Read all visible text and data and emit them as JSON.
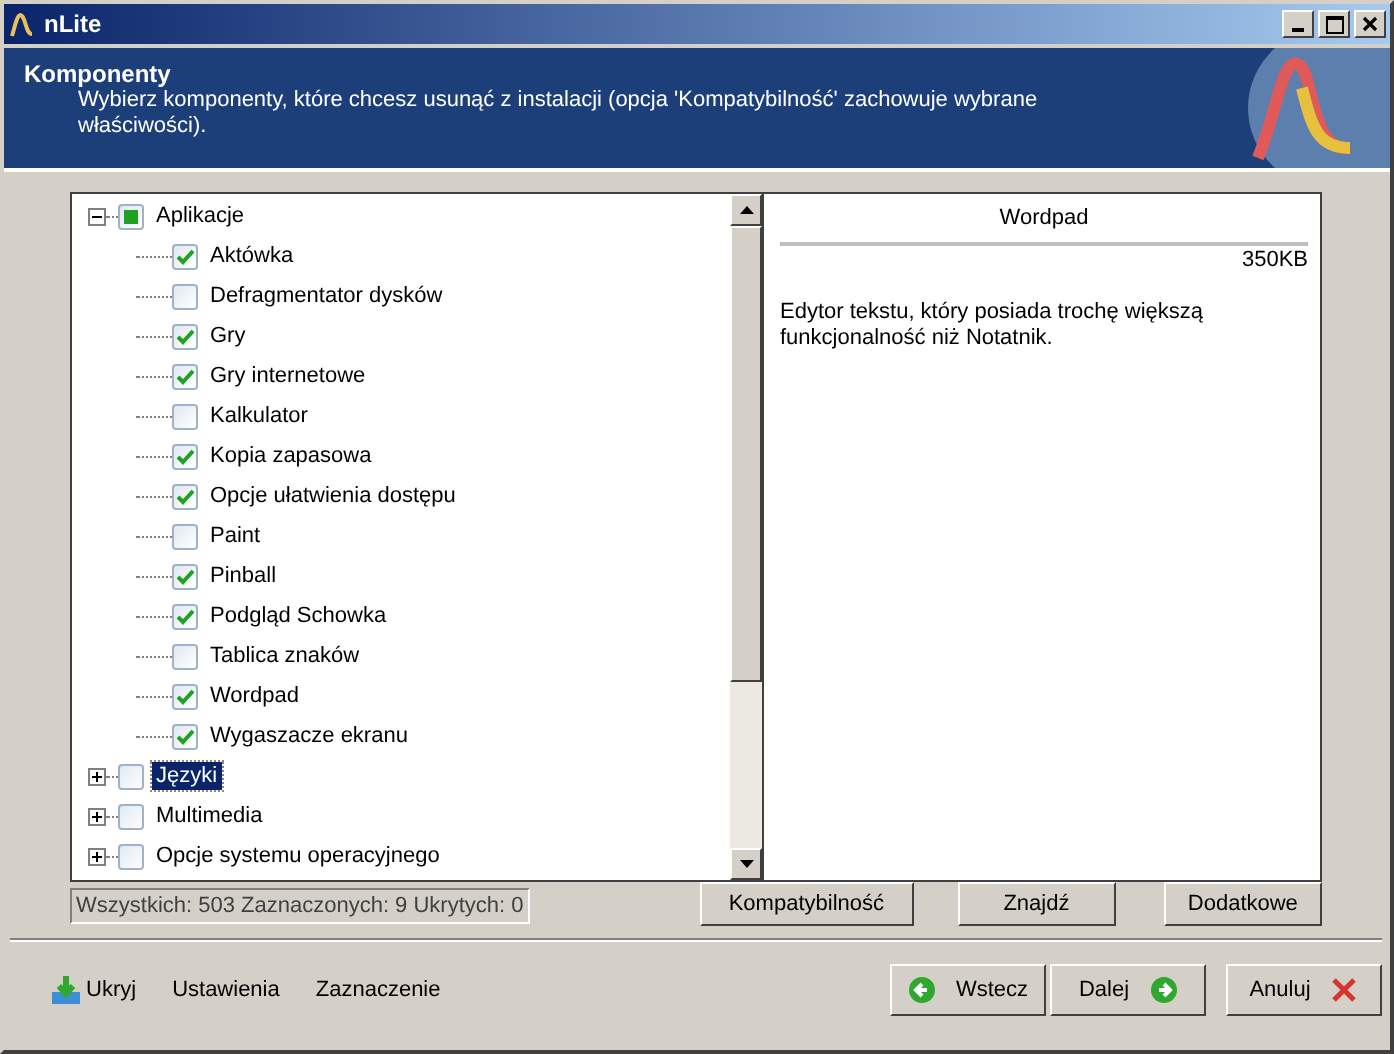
{
  "window": {
    "title": "nLite"
  },
  "header": {
    "title": "Komponenty",
    "subtitle": "Wybierz komponenty, które chcesz usunąć z instalacji (opcja 'Kompatybilność' zachowuje wybrane właściwości)."
  },
  "tree": [
    {
      "label": "Aplikacje",
      "checked": false,
      "partial": true,
      "expanded": true,
      "selected": false,
      "children": [
        {
          "label": "Aktówka",
          "checked": true,
          "selected": false
        },
        {
          "label": "Defragmentator dysków",
          "checked": false,
          "selected": false
        },
        {
          "label": "Gry",
          "checked": true,
          "selected": false
        },
        {
          "label": "Gry internetowe",
          "checked": true,
          "selected": false
        },
        {
          "label": "Kalkulator",
          "checked": false,
          "selected": false
        },
        {
          "label": "Kopia zapasowa",
          "checked": true,
          "selected": false
        },
        {
          "label": "Opcje ułatwienia dostępu",
          "checked": true,
          "selected": false
        },
        {
          "label": "Paint",
          "checked": false,
          "selected": false
        },
        {
          "label": "Pinball",
          "checked": true,
          "selected": false
        },
        {
          "label": "Podgląd Schowka",
          "checked": true,
          "selected": false
        },
        {
          "label": "Tablica znaków",
          "checked": false,
          "selected": false
        },
        {
          "label": "Wordpad",
          "checked": true,
          "selected": false
        },
        {
          "label": "Wygaszacze ekranu",
          "checked": true,
          "selected": false
        }
      ]
    },
    {
      "label": "Języki",
      "checked": false,
      "expanded": false,
      "selected": true
    },
    {
      "label": "Multimedia",
      "checked": false,
      "expanded": false,
      "selected": false
    },
    {
      "label": "Opcje systemu operacyjnego",
      "checked": false,
      "expanded": false,
      "selected": false
    }
  ],
  "details": {
    "title": "Wordpad",
    "size": "350KB",
    "description": "Edytor tekstu, który posiada trochę większą funkcjonalność niż Notatnik."
  },
  "status": "Wszystkich: 503 Zaznaczonych: 9 Ukrytych: 0",
  "panel_buttons": [
    "Kompatybilność",
    "Znajdź",
    "Dodatkowe"
  ],
  "bottom_links": [
    {
      "label": "Ukryj",
      "kind": "icon"
    },
    {
      "label": "Ustawienia",
      "kind": "text"
    },
    {
      "label": "Zaznaczenie",
      "kind": "text"
    }
  ],
  "nav_buttons": [
    {
      "label": "Wstecz",
      "kind": "back"
    },
    {
      "label": "Dalej",
      "kind": "next"
    },
    {
      "label": "Anuluj",
      "kind": "cancel"
    }
  ]
}
